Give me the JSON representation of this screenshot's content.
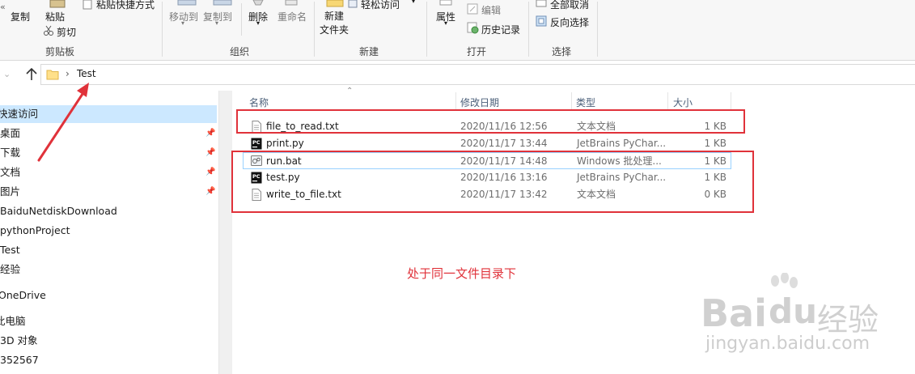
{
  "ribbon": {
    "copy": "复制",
    "paste": "粘贴",
    "paste_shortcut": "粘贴快捷方式",
    "cut": "剪切",
    "move_to": "移动到",
    "copy_to": "复制到",
    "delete": "删除",
    "rename": "重命名",
    "new_folder_line1": "新建",
    "new_folder_line2": "文件夹",
    "easy_access": "轻松访问",
    "properties": "属性",
    "edit": "编辑",
    "history": "历史记录",
    "select_none": "全部取消",
    "invert_selection": "反向选择",
    "groups": {
      "clipboard": "剪贴板",
      "organize": "组织",
      "new": "新建",
      "open": "打开",
      "select": "选择"
    }
  },
  "address_bar": {
    "path": [
      "Test"
    ]
  },
  "nav": {
    "items": [
      {
        "label": "快速访问",
        "selected": true,
        "pinned": false
      },
      {
        "label": "桌面",
        "selected": false,
        "pinned": true
      },
      {
        "label": "下载",
        "selected": false,
        "pinned": true
      },
      {
        "label": "文档",
        "selected": false,
        "pinned": true
      },
      {
        "label": "图片",
        "selected": false,
        "pinned": true
      },
      {
        "label": "BaiduNetdiskDownload",
        "selected": false,
        "pinned": false
      },
      {
        "label": "pythonProject",
        "selected": false,
        "pinned": false
      },
      {
        "label": "Test",
        "selected": false,
        "pinned": false
      },
      {
        "label": "经验",
        "selected": false,
        "pinned": false
      },
      {
        "label": "OneDrive",
        "selected": false,
        "pinned": false
      },
      {
        "label": "此电脑",
        "selected": false,
        "pinned": false
      },
      {
        "label": "3D 对象",
        "selected": false,
        "pinned": false
      },
      {
        "label": "352567",
        "selected": false,
        "pinned": false
      }
    ]
  },
  "columns": {
    "name": "名称",
    "date": "修改日期",
    "type": "类型",
    "size": "大小"
  },
  "files": [
    {
      "name": "file_to_read.txt",
      "date": "2020/11/16 12:56",
      "type": "文本文档",
      "size": "1 KB",
      "icon": "text-file-icon"
    },
    {
      "name": "print.py",
      "date": "2020/11/17 13:44",
      "type": "JetBrains PyChar...",
      "size": "1 KB",
      "icon": "pycharm-icon"
    },
    {
      "name": "run.bat",
      "date": "2020/11/17 14:48",
      "type": "Windows 批处理...",
      "size": "1 KB",
      "icon": "batch-file-icon"
    },
    {
      "name": "test.py",
      "date": "2020/11/16 13:16",
      "type": "JetBrains PyChar...",
      "size": "1 KB",
      "icon": "pycharm-icon"
    },
    {
      "name": "write_to_file.txt",
      "date": "2020/11/17 13:42",
      "type": "文本文档",
      "size": "0 KB",
      "icon": "text-file-icon"
    }
  ],
  "annotation": "处于同一文件目录下",
  "watermark": {
    "brand": "Bai",
    "paw": "du",
    "cn": "经验",
    "url": "jingyan.baidu.com"
  },
  "colors": {
    "annotation_red": "#e0323a",
    "selection_blue": "#cce8ff",
    "hover_border": "#99d1ff"
  }
}
